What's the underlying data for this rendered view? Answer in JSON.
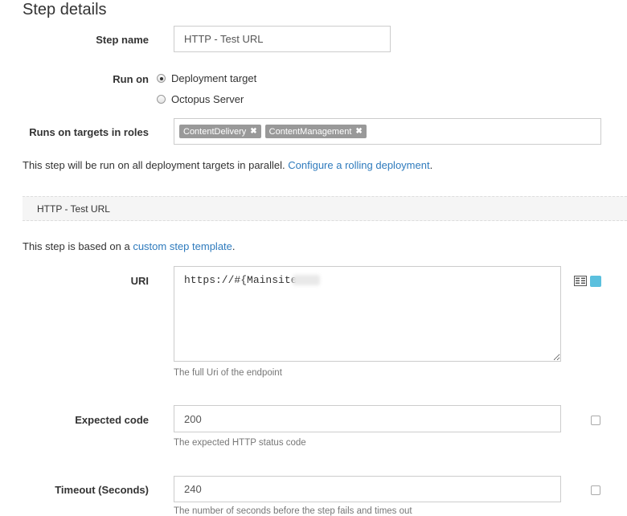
{
  "header": {
    "title": "Step details"
  },
  "step_name": {
    "label": "Step name",
    "value": "HTTP - Test URL"
  },
  "run_on": {
    "label": "Run on",
    "options": [
      {
        "label": "Deployment target",
        "selected": true
      },
      {
        "label": "Octopus Server",
        "selected": false
      }
    ]
  },
  "roles": {
    "label": "Runs on targets in roles",
    "tags": [
      "ContentDelivery",
      "ContentManagement"
    ],
    "remove_glyph": "✖"
  },
  "parallel_info": {
    "text": "This step will be run on all deployment targets in parallel.",
    "link": "Configure a rolling deployment",
    "suffix": "."
  },
  "section": {
    "title": "HTTP - Test URL"
  },
  "template_info": {
    "text": "This step is based on a",
    "link": "custom step template",
    "suffix": "."
  },
  "uri": {
    "label": "URI",
    "value": "https://#{Mainsite",
    "help": "The full Uri of the endpoint",
    "binding_color": "#5bc0de"
  },
  "expected_code": {
    "label": "Expected code",
    "value": "200",
    "help": "The expected HTTP status code"
  },
  "timeout": {
    "label": "Timeout (Seconds)",
    "value": "240",
    "help": "The number of seconds before the step fails and times out"
  }
}
